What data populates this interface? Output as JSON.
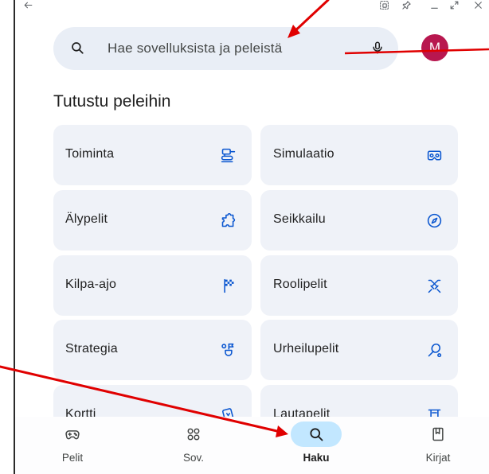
{
  "window": {
    "controls": [
      "back-arrow-icon",
      "snap-window-icon",
      "pin-icon",
      "minimize-icon",
      "maximize-icon",
      "close-icon"
    ]
  },
  "search": {
    "placeholder": "Hae sovelluksista ja peleistä",
    "leading_icon": "search-icon",
    "voice_icon": "mic-icon"
  },
  "account": {
    "avatar_letter": "M"
  },
  "section": {
    "title": "Tutustu peleihin"
  },
  "categories": [
    {
      "label": "Toiminta",
      "icon": "tank-icon"
    },
    {
      "label": "Simulaatio",
      "icon": "vr-headset-icon"
    },
    {
      "label": "Älypelit",
      "icon": "puzzle-icon"
    },
    {
      "label": "Seikkailu",
      "icon": "compass-icon"
    },
    {
      "label": "Kilpa-ajo",
      "icon": "checkered-flag-icon"
    },
    {
      "label": "Roolipelit",
      "icon": "crossed-swords-icon"
    },
    {
      "label": "Strategia",
      "icon": "strategy-icon"
    },
    {
      "label": "Urheilupelit",
      "icon": "racket-icon"
    },
    {
      "label": "Kortti",
      "icon": "card-icon"
    },
    {
      "label": "Lautapelit",
      "icon": "board-game-icon"
    }
  ],
  "bottom_nav": {
    "tabs": [
      {
        "label": "Pelit",
        "icon": "gamepad-icon",
        "active": false
      },
      {
        "label": "Sov.",
        "icon": "apps-icon",
        "active": false
      },
      {
        "label": "Haku",
        "icon": "search-icon",
        "active": true
      },
      {
        "label": "Kirjat",
        "icon": "book-icon",
        "active": false
      }
    ]
  },
  "theme": {
    "accent": "#0b57d0",
    "text": "#1f1f1f",
    "muted_text": "#444746",
    "search_bg": "#e9eef6",
    "card_bg": "#eff2f8",
    "avatar_bg": "#b8174f",
    "active_tab_bg": "#c2e7ff",
    "annotation": "#e00000",
    "chrome_icon": "#5f6368",
    "nav_bg": "#fdfdfe"
  }
}
